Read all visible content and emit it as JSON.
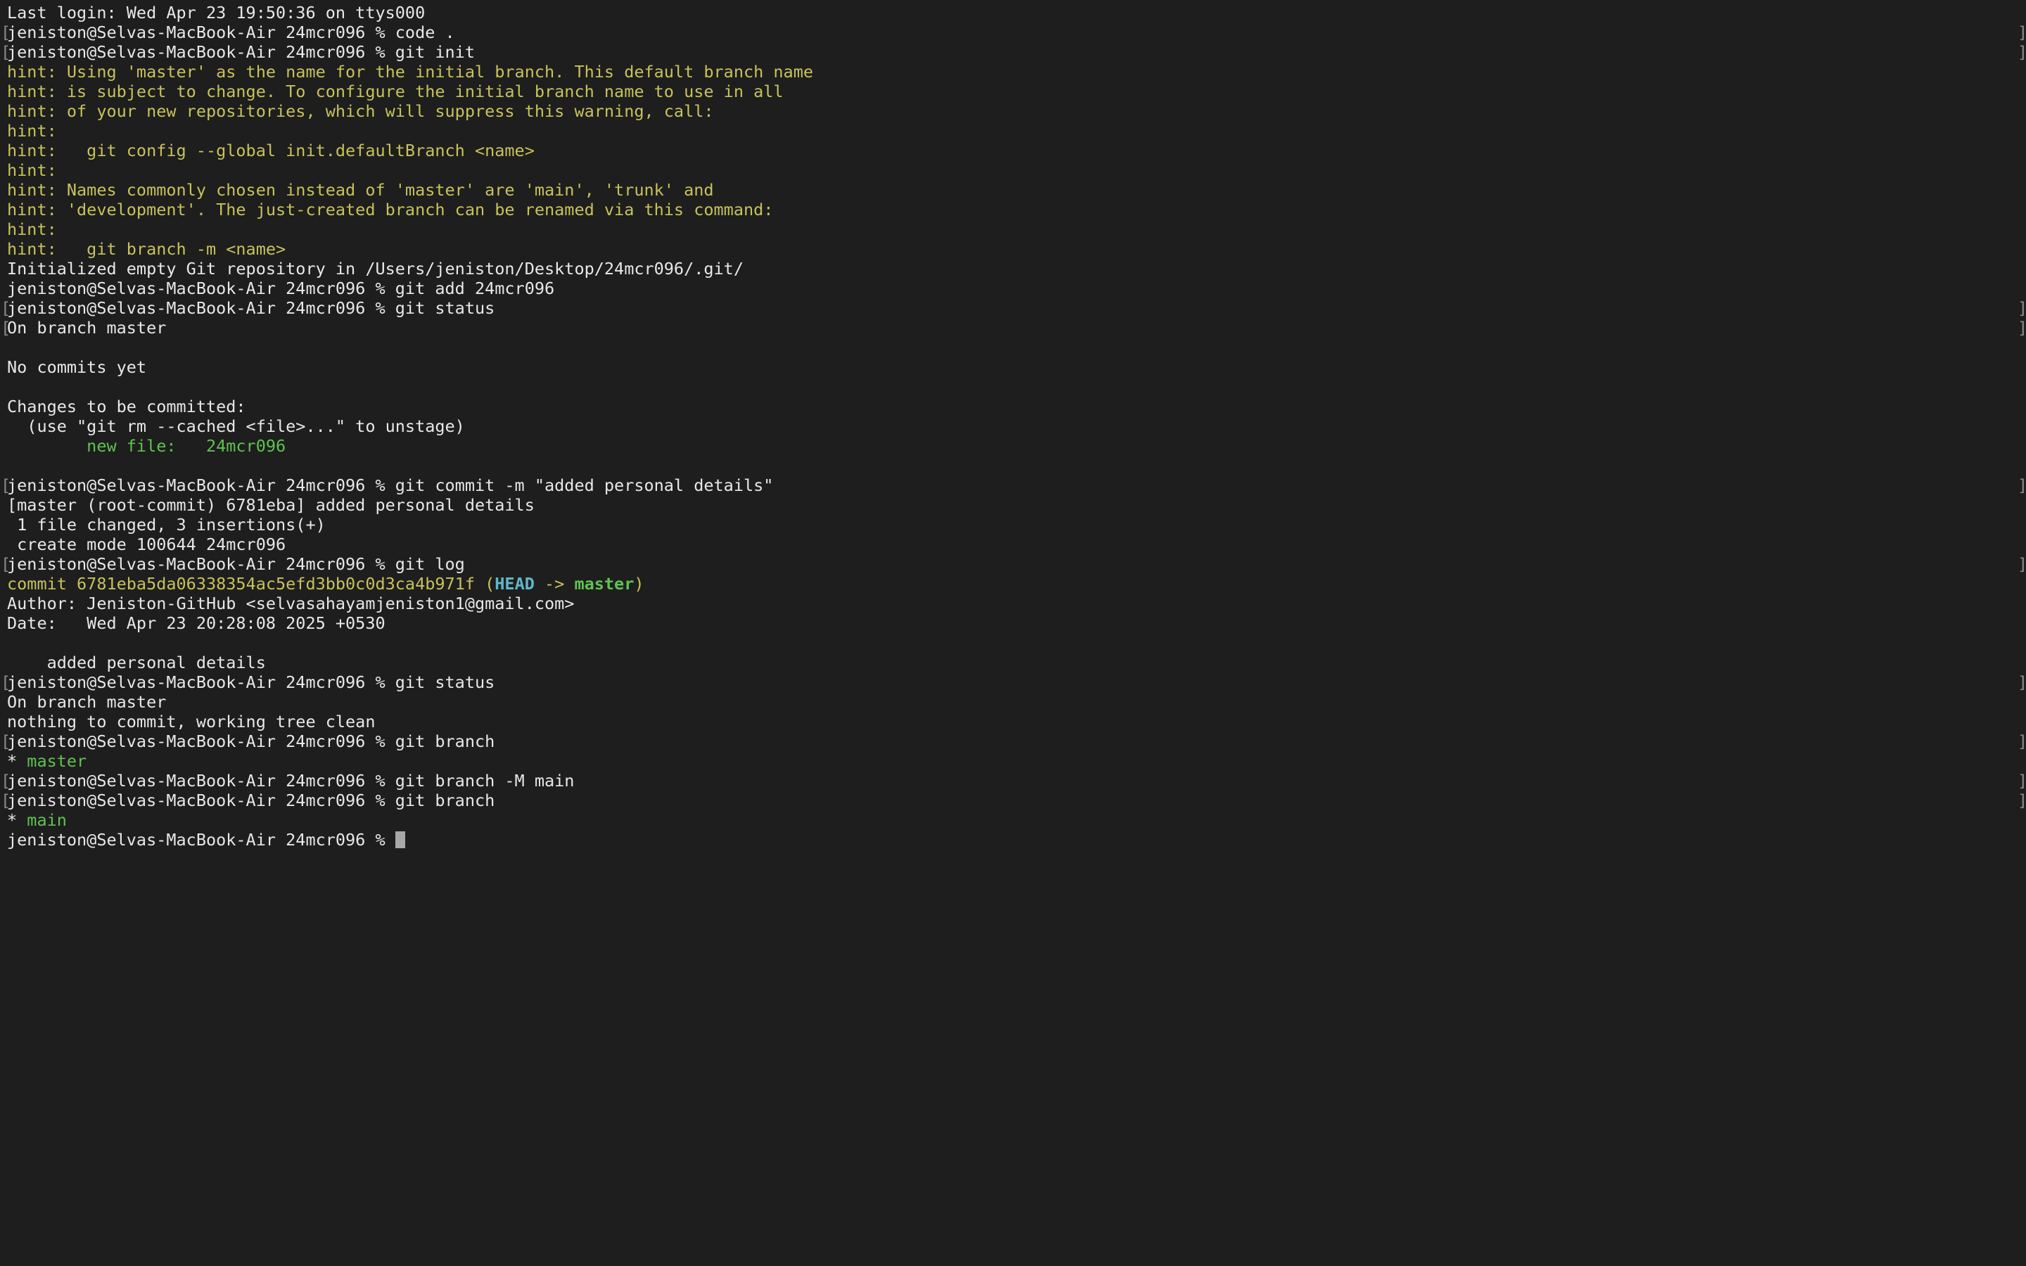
{
  "terminal": {
    "lines": [
      {
        "segments": [
          {
            "t": "Last login: Wed Apr 23 19:50:36 on ttys000",
            "c": "default"
          }
        ]
      },
      {
        "bracket": true,
        "segments": [
          {
            "t": "jeniston@Selvas-MacBook-Air 24mcr096 % code .",
            "c": "default"
          }
        ]
      },
      {
        "bracket": true,
        "segments": [
          {
            "t": "jeniston@Selvas-MacBook-Air 24mcr096 % git init",
            "c": "default"
          }
        ]
      },
      {
        "segments": [
          {
            "t": "hint: Using 'master' as the name for the initial branch. This default branch name",
            "c": "yellow"
          }
        ]
      },
      {
        "segments": [
          {
            "t": "hint: is subject to change. To configure the initial branch name to use in all",
            "c": "yellow"
          }
        ]
      },
      {
        "segments": [
          {
            "t": "hint: of your new repositories, which will suppress this warning, call:",
            "c": "yellow"
          }
        ]
      },
      {
        "segments": [
          {
            "t": "hint:",
            "c": "yellow"
          }
        ]
      },
      {
        "segments": [
          {
            "t": "hint:   git config --global init.defaultBranch <name>",
            "c": "yellow"
          }
        ]
      },
      {
        "segments": [
          {
            "t": "hint:",
            "c": "yellow"
          }
        ]
      },
      {
        "segments": [
          {
            "t": "hint: Names commonly chosen instead of 'master' are 'main', 'trunk' and",
            "c": "yellow"
          }
        ]
      },
      {
        "segments": [
          {
            "t": "hint: 'development'. The just-created branch can be renamed via this command:",
            "c": "yellow"
          }
        ]
      },
      {
        "segments": [
          {
            "t": "hint:",
            "c": "yellow"
          }
        ]
      },
      {
        "segments": [
          {
            "t": "hint:   git branch -m <name>",
            "c": "yellow"
          }
        ]
      },
      {
        "segments": [
          {
            "t": "Initialized empty Git repository in /Users/jeniston/Desktop/24mcr096/.git/",
            "c": "default"
          }
        ]
      },
      {
        "segments": [
          {
            "t": "jeniston@Selvas-MacBook-Air 24mcr096 % git add 24mcr096",
            "c": "default"
          }
        ]
      },
      {
        "bracket": true,
        "segments": [
          {
            "t": "jeniston@Selvas-MacBook-Air 24mcr096 % git status",
            "c": "default"
          }
        ]
      },
      {
        "bracket": true,
        "segments": [
          {
            "t": "On branch master",
            "c": "default"
          }
        ]
      },
      {
        "segments": [
          {
            "t": "",
            "c": "default"
          }
        ]
      },
      {
        "segments": [
          {
            "t": "No commits yet",
            "c": "default"
          }
        ]
      },
      {
        "segments": [
          {
            "t": "",
            "c": "default"
          }
        ]
      },
      {
        "segments": [
          {
            "t": "Changes to be committed:",
            "c": "default"
          }
        ]
      },
      {
        "segments": [
          {
            "t": "  (use \"git rm --cached <file>...\" to unstage)",
            "c": "default"
          }
        ]
      },
      {
        "segments": [
          {
            "t": "        new file:   24mcr096",
            "c": "green"
          }
        ]
      },
      {
        "segments": [
          {
            "t": "",
            "c": "default"
          }
        ]
      },
      {
        "bracket": true,
        "segments": [
          {
            "t": "jeniston@Selvas-MacBook-Air 24mcr096 % git commit -m \"added personal details\"",
            "c": "default"
          }
        ]
      },
      {
        "segments": [
          {
            "t": "[master (root-commit) 6781eba] added personal details",
            "c": "default"
          }
        ]
      },
      {
        "segments": [
          {
            "t": " 1 file changed, 3 insertions(+)",
            "c": "default"
          }
        ]
      },
      {
        "segments": [
          {
            "t": " create mode 100644 24mcr096",
            "c": "default"
          }
        ]
      },
      {
        "bracket": true,
        "segments": [
          {
            "t": "jeniston@Selvas-MacBook-Air 24mcr096 % git log",
            "c": "default"
          }
        ]
      },
      {
        "segments": [
          {
            "t": "commit 6781eba5da06338354ac5efd3bb0c0d3ca4b971f ",
            "c": "yellow"
          },
          {
            "t": "(",
            "c": "yellow"
          },
          {
            "t": "HEAD",
            "c": "cyan"
          },
          {
            "t": " -> ",
            "c": "yellow"
          },
          {
            "t": "master",
            "c": "greenbold"
          },
          {
            "t": ")",
            "c": "yellow"
          }
        ]
      },
      {
        "segments": [
          {
            "t": "Author: Jeniston-GitHub <selvasahayamjeniston1@gmail.com>",
            "c": "default"
          }
        ]
      },
      {
        "segments": [
          {
            "t": "Date:   Wed Apr 23 20:28:08 2025 +0530",
            "c": "default"
          }
        ]
      },
      {
        "segments": [
          {
            "t": "",
            "c": "default"
          }
        ]
      },
      {
        "segments": [
          {
            "t": "    added personal details",
            "c": "default"
          }
        ]
      },
      {
        "bracket": true,
        "segments": [
          {
            "t": "jeniston@Selvas-MacBook-Air 24mcr096 % git status",
            "c": "default"
          }
        ]
      },
      {
        "segments": [
          {
            "t": "On branch master",
            "c": "default"
          }
        ]
      },
      {
        "segments": [
          {
            "t": "nothing to commit, working tree clean",
            "c": "default"
          }
        ]
      },
      {
        "bracket": true,
        "segments": [
          {
            "t": "jeniston@Selvas-MacBook-Air 24mcr096 % git branch",
            "c": "default"
          }
        ]
      },
      {
        "segments": [
          {
            "t": "* ",
            "c": "default"
          },
          {
            "t": "master",
            "c": "green"
          }
        ]
      },
      {
        "bracket": true,
        "segments": [
          {
            "t": "jeniston@Selvas-MacBook-Air 24mcr096 % git branch -M main",
            "c": "default"
          }
        ]
      },
      {
        "bracket": true,
        "segments": [
          {
            "t": "jeniston@Selvas-MacBook-Air 24mcr096 % git branch",
            "c": "default"
          }
        ]
      },
      {
        "segments": [
          {
            "t": "* ",
            "c": "default"
          },
          {
            "t": "main",
            "c": "green"
          }
        ]
      }
    ],
    "prompt": "jeniston@Selvas-MacBook-Air 24mcr096 % ",
    "colors": {
      "background": "#1e1e1e",
      "default": "#e8e8e8",
      "yellow": "#c8c25a",
      "green": "#5fc34f",
      "cyan": "#5fb8c9",
      "cursor": "#a8a8a8"
    },
    "cursor_icon": "block-cursor"
  }
}
